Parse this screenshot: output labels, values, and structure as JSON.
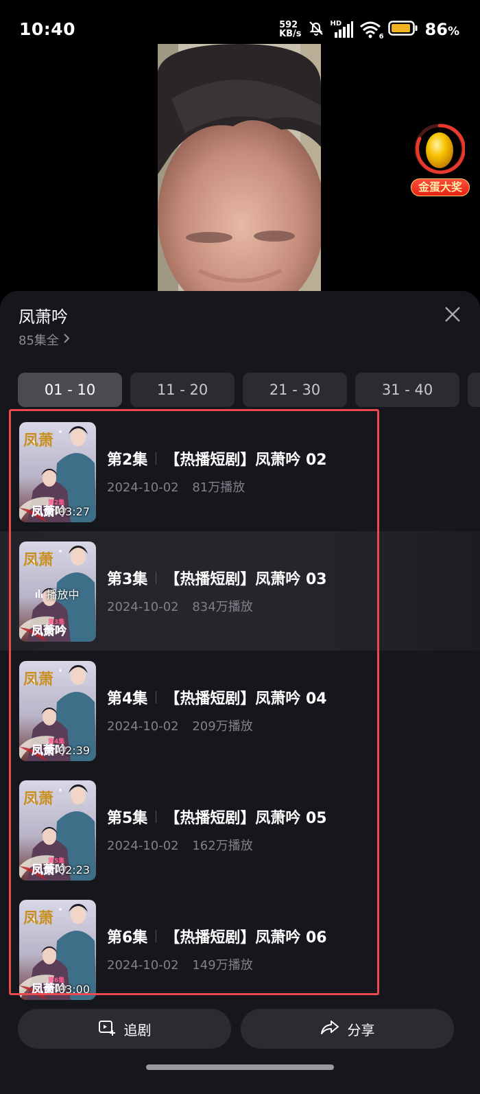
{
  "status_bar": {
    "time": "10:40",
    "net_speed_value": "592",
    "net_speed_unit": "KB/s",
    "network_tag": "HD",
    "wifi_tag": "6",
    "battery_percent": "86",
    "battery_suffix": "%"
  },
  "egg_widget": {
    "label": "金蛋大奖"
  },
  "sheet": {
    "title": "凤萧吟",
    "subtitle": "85集全"
  },
  "range_tabs": [
    {
      "label": "01 - 10",
      "active": true
    },
    {
      "label": "11 - 20",
      "active": false
    },
    {
      "label": "21 - 30",
      "active": false
    },
    {
      "label": "31 - 40",
      "active": false
    }
  ],
  "episodes": [
    {
      "number": "第2集",
      "title": "【热播短剧】凤萧吟 02",
      "date": "2024-10-02",
      "views": "81万播放",
      "duration": "03:27",
      "poster_tag": "第2集",
      "playing": false
    },
    {
      "number": "第3集",
      "title": "【热播短剧】凤萧吟 03",
      "date": "2024-10-02",
      "views": "834万播放",
      "duration": "",
      "poster_tag": "第3集",
      "playing": true,
      "playing_label": "播放中"
    },
    {
      "number": "第4集",
      "title": "【热播短剧】凤萧吟 04",
      "date": "2024-10-02",
      "views": "209万播放",
      "duration": "02:39",
      "poster_tag": "第4集",
      "playing": false
    },
    {
      "number": "第5集",
      "title": "【热播短剧】凤萧吟 05",
      "date": "2024-10-02",
      "views": "162万播放",
      "duration": "02:23",
      "poster_tag": "第5集",
      "playing": false
    },
    {
      "number": "第6集",
      "title": "【热播短剧】凤萧吟 06",
      "date": "2024-10-02",
      "views": "149万播放",
      "duration": "03:00",
      "poster_tag": "第6集",
      "playing": false
    }
  ],
  "poster": {
    "calligraphy": "凤萧吟"
  },
  "actions": {
    "follow_label": "追剧",
    "share_label": "分享"
  },
  "colors": {
    "sheet_bg": "#16171c",
    "tab_active": "#4b4c52",
    "tab_inactive": "#2b2c31",
    "highlight": "#e84a4f",
    "egg_gold": "#f7b800"
  }
}
